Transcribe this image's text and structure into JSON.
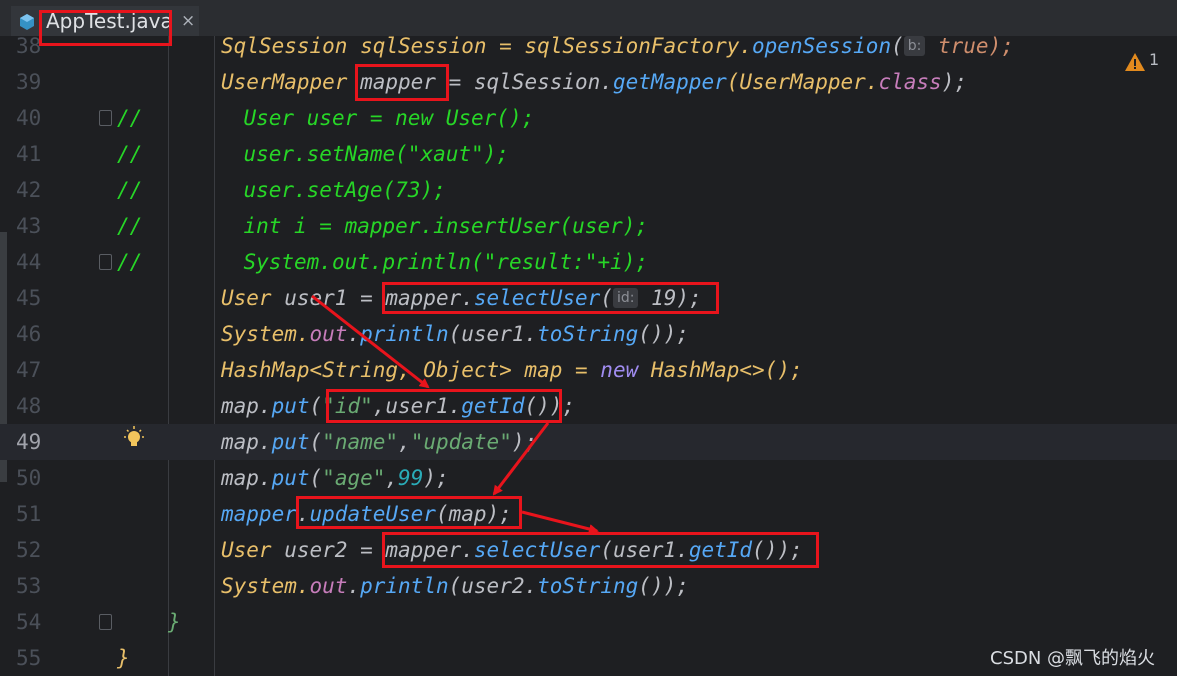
{
  "tab": {
    "title": "AppTest.java",
    "close": "×",
    "icon": "java-class-icon"
  },
  "inspection": {
    "warning_count": "1",
    "icon": "warning-icon"
  },
  "lines": {
    "l38": {
      "num": "38",
      "t1": "SqlSession sqlSession = sqlSessionFactory.",
      "t2": "openSession",
      "t3": "(",
      "hint": "b:",
      "t4": " true);"
    },
    "l39": {
      "num": "39",
      "t1": "UserMapper ",
      "t2": "mapper",
      "t3": " = sqlSession.",
      "t4": "getMapper",
      "t5": "(UserMapper.",
      "t6": "class",
      "t7": ");"
    },
    "l40": {
      "num": "40",
      "slash": "//",
      "t1": "        User user = new User();"
    },
    "l41": {
      "num": "41",
      "slash": "//",
      "t1": "        user.setName(\"xaut\");"
    },
    "l42": {
      "num": "42",
      "slash": "//",
      "t1": "        user.setAge(73);"
    },
    "l43": {
      "num": "43",
      "slash": "//",
      "t1": "        int i = mapper.insertUser(user);"
    },
    "l44": {
      "num": "44",
      "slash": "//",
      "t1": "        System.out.println(\"result:\"+i);"
    },
    "l45": {
      "num": "45",
      "t1": "User ",
      "t2": "user1",
      "t3": " = mapper.",
      "t4": "selectUser",
      "t5": "(",
      "hint": "id:",
      "t6": " 19);"
    },
    "l46": {
      "num": "46",
      "t1": "System.",
      "t2": "out",
      "t3": ".",
      "t4": "println",
      "t5": "(user1.",
      "t6": "toString",
      "t7": "());"
    },
    "l47": {
      "num": "47",
      "t1": "HashMap<String, Object> map = ",
      "t2": "new",
      "t3": " HashMap<>();"
    },
    "l48": {
      "num": "48",
      "t1": "map.",
      "t2": "put",
      "t3": "(",
      "t4": "\"id\"",
      "t5": ",user1.",
      "t6": "getId",
      "t7": "());"
    },
    "l49": {
      "num": "49",
      "t1": "map.",
      "t2": "put",
      "t3": "(",
      "t4": "\"name\"",
      "t5": ",",
      "t6": "\"update\"",
      "t7": ");"
    },
    "l50": {
      "num": "50",
      "t1": "map.",
      "t2": "put",
      "t3": "(",
      "t4": "\"age\"",
      "t5": ",",
      "t6": "99",
      "t7": ");"
    },
    "l51": {
      "num": "51",
      "t1": "mapper",
      "t2": ".",
      "t3": "updateUser",
      "t4": "(map);"
    },
    "l52": {
      "num": "52",
      "t1": "User ",
      "t2": "user2",
      "t3": " = mapper.",
      "t4": "selectUser",
      "t5": "(user1.",
      "t6": "getId",
      "t7": "());"
    },
    "l53": {
      "num": "53",
      "t1": "System.",
      "t2": "out",
      "t3": ".",
      "t4": "println",
      "t5": "(user2.",
      "t6": "toString",
      "t7": "());"
    },
    "l54": {
      "num": "54",
      "t1": "}"
    },
    "l55": {
      "num": "55",
      "t1": "}"
    }
  },
  "watermark": "CSDN @飘飞的焰火",
  "colors": {
    "annotation_red": "#e8141c",
    "comment_green": "#27d627",
    "background": "#1e1f22"
  }
}
